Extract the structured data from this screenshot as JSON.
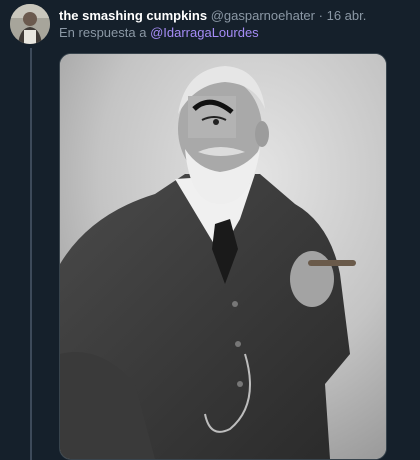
{
  "tweet": {
    "author_name": "the smashing cumpkins",
    "author_handle": "@gasparnoehater",
    "separator": "·",
    "date": "16 abr.",
    "reply_prefix": "En respuesta a",
    "reply_to": "@IdarragaLourdes"
  },
  "colors": {
    "background": "#15202b",
    "name": "#ffffff",
    "secondary_text": "#8b98a5",
    "mention": "#a58cf6"
  },
  "media": {
    "icon": "photo-meme-image"
  }
}
